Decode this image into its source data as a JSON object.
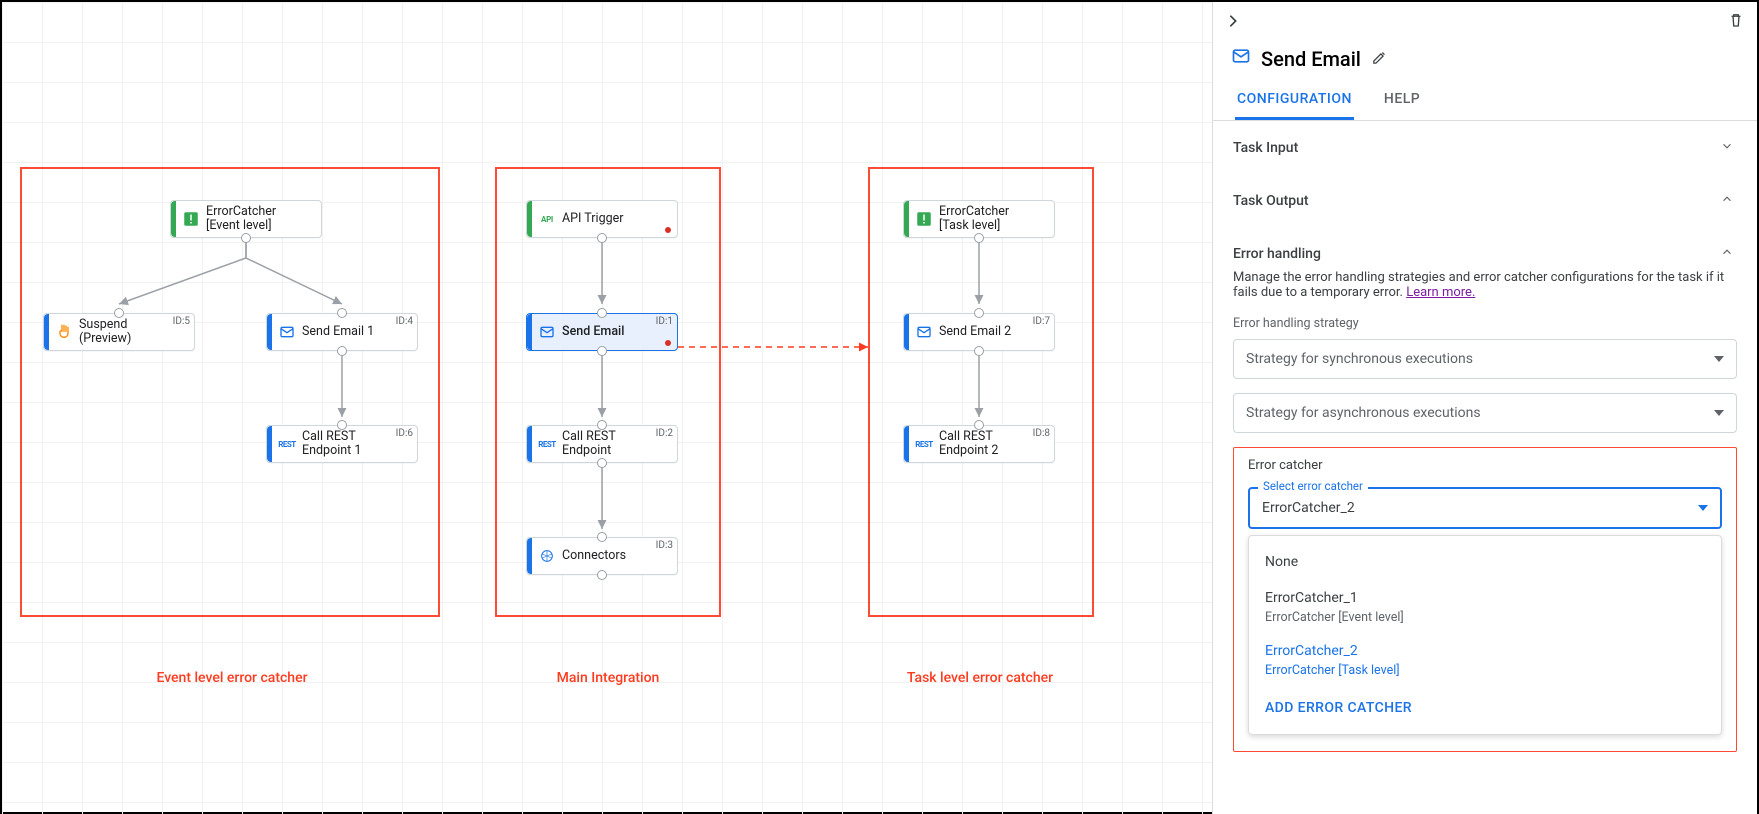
{
  "canvas": {
    "boxes": {
      "event_level": "Event level error catcher",
      "main_integration": "Main Integration",
      "task_level": "Task level error catcher"
    },
    "nodes": {
      "errorcatcher_event": {
        "line1": "ErrorCatcher",
        "line2": "[Event level]"
      },
      "suspend": {
        "line1": "Suspend",
        "line2": "(Preview)",
        "id": "ID:5"
      },
      "sendemail1": {
        "label": "Send Email 1",
        "id": "ID:4"
      },
      "callrest1": {
        "line1": "Call REST",
        "line2": "Endpoint 1",
        "id": "ID:6"
      },
      "apitrigger": {
        "label": "API Trigger"
      },
      "sendemail": {
        "label": "Send Email",
        "id": "ID:1"
      },
      "callrest": {
        "line1": "Call REST",
        "line2": "Endpoint",
        "id": "ID:2"
      },
      "connectors": {
        "label": "Connectors",
        "id": "ID:3"
      },
      "errorcatcher_task": {
        "line1": "ErrorCatcher",
        "line2": "[Task level]"
      },
      "sendemail2": {
        "label": "Send Email 2",
        "id": "ID:7"
      },
      "callrest2": {
        "line1": "Call REST",
        "line2": "Endpoint 2",
        "id": "ID:8"
      }
    }
  },
  "sidebar": {
    "title": "Send Email",
    "tabs": {
      "configuration": "CONFIGURATION",
      "help": "HELP"
    },
    "sections": {
      "task_input": "Task Input",
      "task_output": "Task Output",
      "error_handling": "Error handling"
    },
    "error_desc": "Manage the error handling strategies and error catcher configurations for the task if it fails due to a temporary error.",
    "learn_more": "Learn more.",
    "strategy_label": "Error handling strategy",
    "sync_placeholder": "Strategy for synchronous executions",
    "async_placeholder": "Strategy for asynchronous executions",
    "catcher_label": "Error catcher",
    "select_catcher_label": "Select error catcher",
    "catcher_value": "ErrorCatcher_2",
    "dropdown": {
      "none": "None",
      "ec1_name": "ErrorCatcher_1",
      "ec1_sub": "ErrorCatcher [Event level]",
      "ec2_name": "ErrorCatcher_2",
      "ec2_sub": "ErrorCatcher [Task level]",
      "add": "ADD ERROR CATCHER"
    }
  }
}
